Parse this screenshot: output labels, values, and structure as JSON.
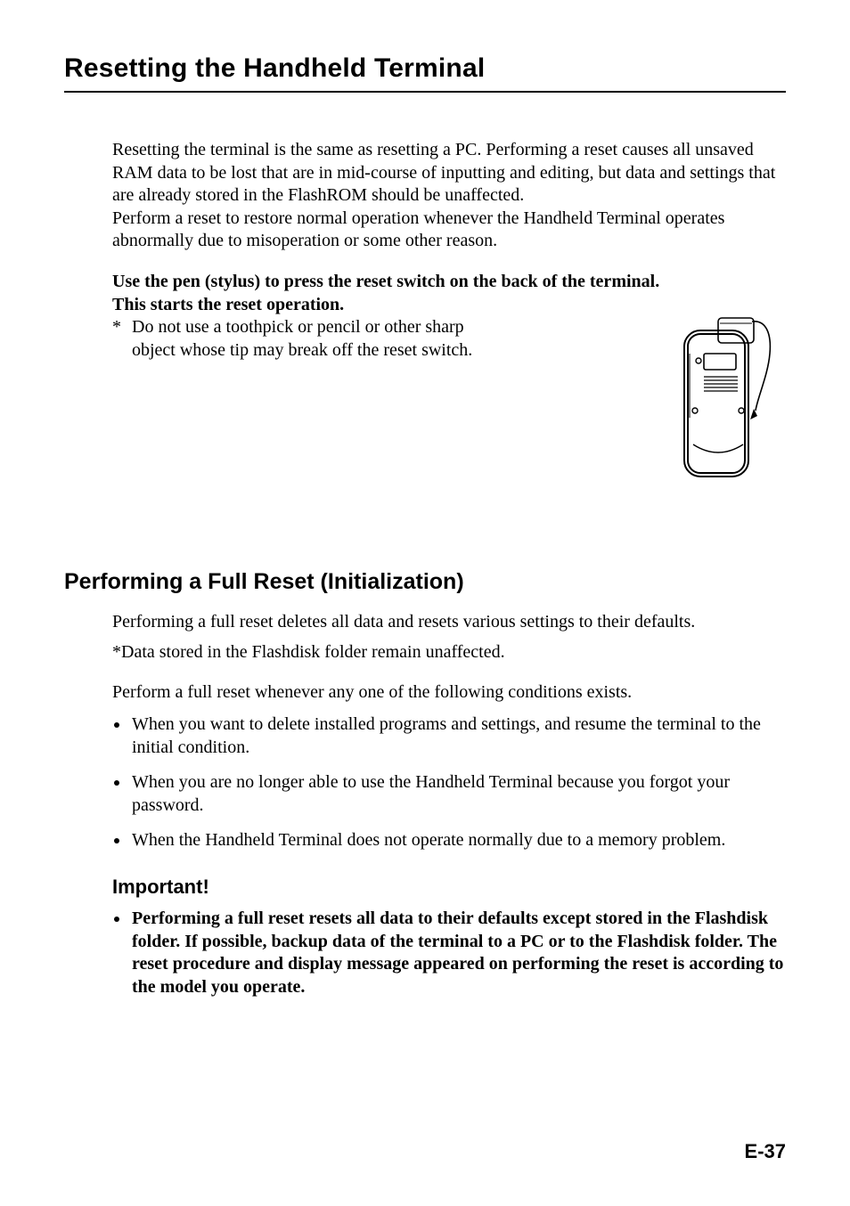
{
  "page": {
    "title": "Resetting the Handheld Terminal",
    "intro_p1": "Resetting the terminal is the same as resetting a PC. Performing a reset causes all unsaved RAM data to be lost that are in mid-course of inputting and editing, but data and settings that are already stored in the FlashROM should be unaffected.",
    "intro_p2": "Perform a reset to restore normal operation whenever the Handheld Terminal operates abnormally due to misoperation or some other reason.",
    "instruction_line1": "Use the pen (stylus) to press the reset switch on the back of the terminal.",
    "instruction_line2": "This starts the reset operation.",
    "star_note_marker": "*",
    "star_note": "Do not use a toothpick or pencil or other sharp object whose tip may break off the reset switch.",
    "section2_heading": "Performing a Full Reset (Initialization)",
    "section2_p1": "Performing a full reset deletes all data and resets various settings to their defaults.",
    "section2_p2": "*Data stored in the Flashdisk folder remain unaffected.",
    "section2_p3": "Perform a full reset whenever any one of the following conditions exists.",
    "section2_bullets": [
      "When you want to delete installed programs and settings, and resume the terminal to the initial condition.",
      "When you are no longer able to use the Handheld Terminal because you forgot your password.",
      "When the Handheld Terminal does not operate normally due to a memory problem."
    ],
    "important_heading": "Important!",
    "important_bullet": "Performing a full reset resets all data to their defaults except stored in the Flashdisk folder. If possible, backup data of the terminal to a PC or to the Flashdisk folder. The reset procedure and display message appeared on performing the reset is according to the model you operate.",
    "page_number": "E-37"
  }
}
